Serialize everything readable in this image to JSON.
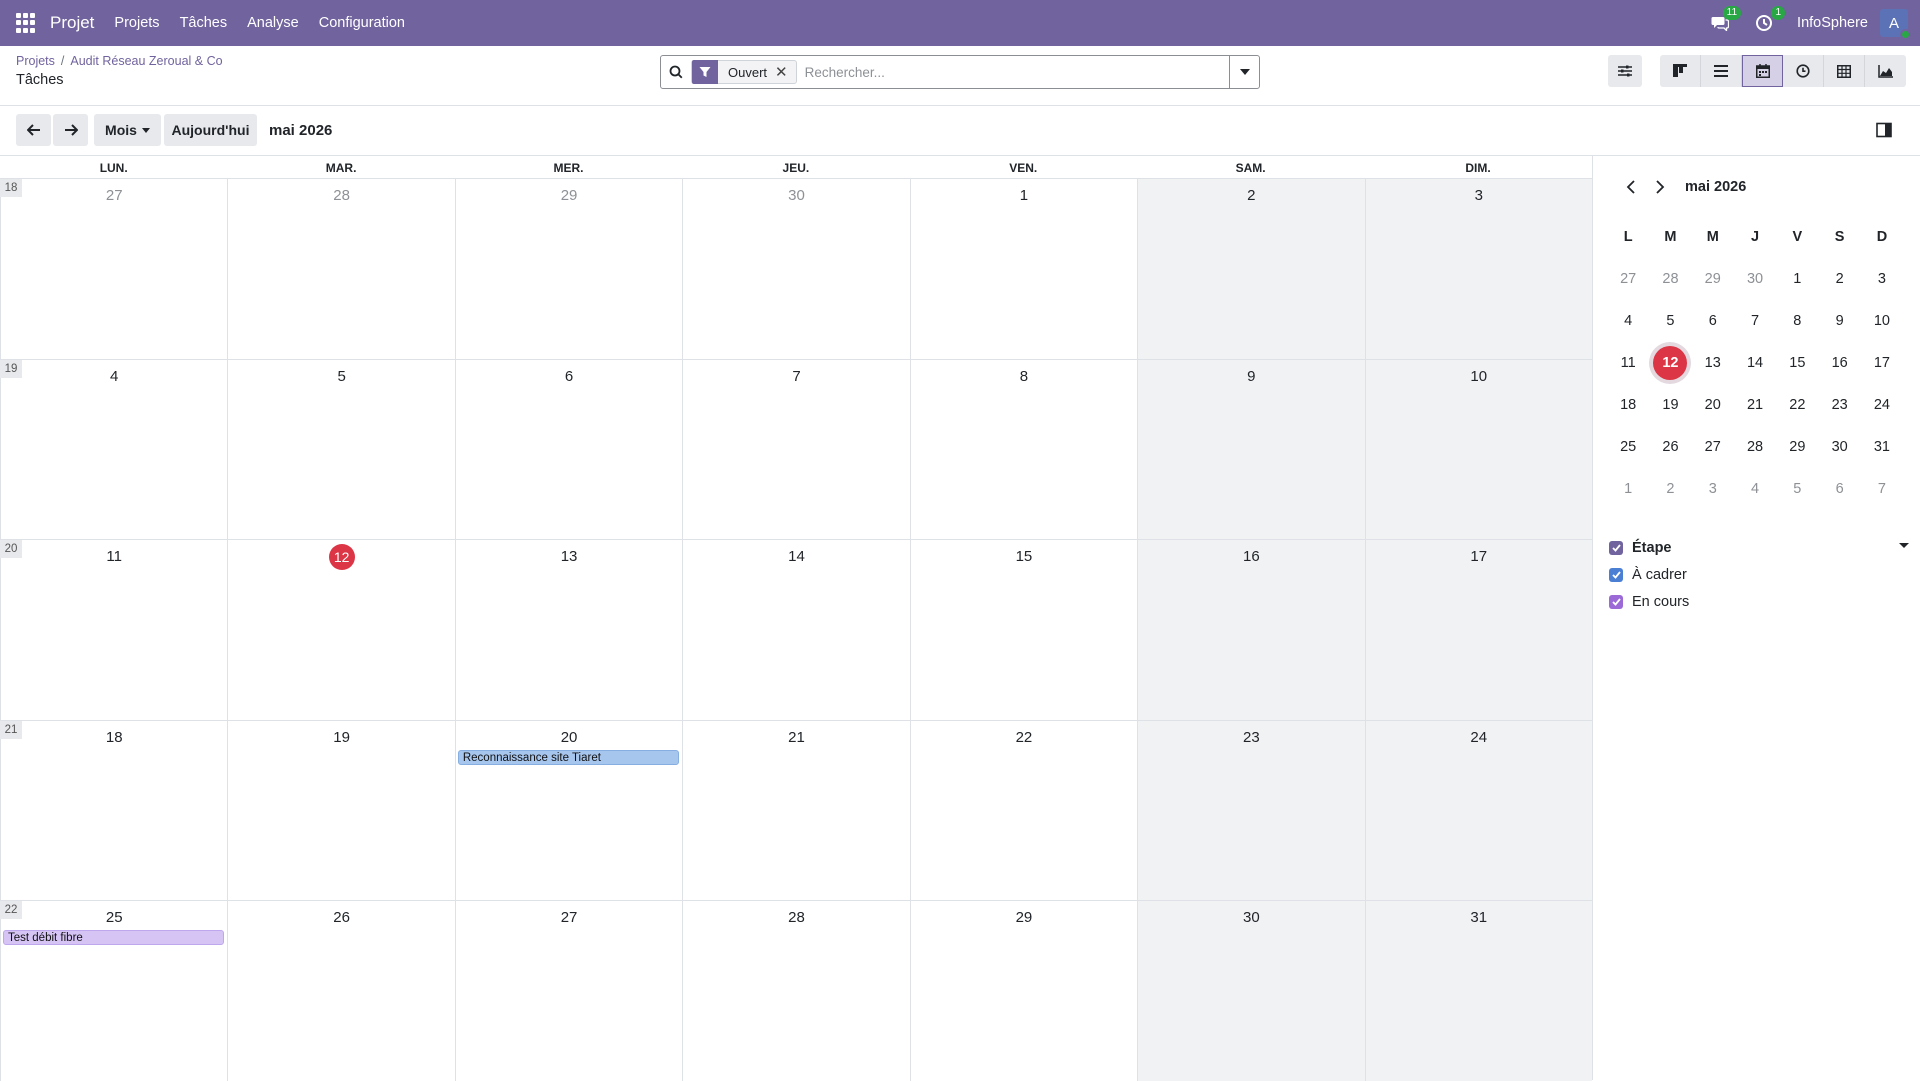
{
  "nav": {
    "app_name": "Projet",
    "menu": [
      "Projets",
      "Tâches",
      "Analyse",
      "Configuration"
    ],
    "chat_count": "11",
    "activity_count": "1",
    "company": "InfoSphere",
    "avatar_letter": "A"
  },
  "breadcrumb": {
    "root": "Projets",
    "project": "Audit Réseau Zeroual & Co"
  },
  "page_title": "Tâches",
  "search": {
    "facet": "Ouvert",
    "placeholder": "Rechercher..."
  },
  "toolbar": {
    "scale": "Mois",
    "today": "Aujourd'hui",
    "range": "mai 2026"
  },
  "calendar": {
    "days_of_week": [
      "LUN.",
      "MAR.",
      "MER.",
      "JEU.",
      "VEN.",
      "SAM.",
      "DIM."
    ],
    "weeks": [
      {
        "number": "18",
        "days": [
          "27",
          "28",
          "29",
          "30",
          "1",
          "2",
          "3"
        ],
        "outside": [
          true,
          true,
          true,
          true,
          false,
          false,
          false
        ]
      },
      {
        "number": "19",
        "days": [
          "4",
          "5",
          "6",
          "7",
          "8",
          "9",
          "10"
        ],
        "outside": [
          false,
          false,
          false,
          false,
          false,
          false,
          false
        ]
      },
      {
        "number": "20",
        "days": [
          "11",
          "12",
          "13",
          "14",
          "15",
          "16",
          "17"
        ],
        "outside": [
          false,
          false,
          false,
          false,
          false,
          false,
          false
        ]
      },
      {
        "number": "21",
        "days": [
          "18",
          "19",
          "20",
          "21",
          "22",
          "23",
          "24"
        ],
        "outside": [
          false,
          false,
          false,
          false,
          false,
          false,
          false
        ]
      },
      {
        "number": "22",
        "days": [
          "25",
          "26",
          "27",
          "28",
          "29",
          "30",
          "31"
        ],
        "outside": [
          false,
          false,
          false,
          false,
          false,
          false,
          false
        ]
      }
    ],
    "today": "12",
    "events": [
      {
        "title": "Reconnaissance site Tiaret",
        "date": "2026-05-20",
        "color": "blue"
      },
      {
        "title": "Test débit fibre",
        "date": "2026-05-25",
        "color": "purple"
      }
    ]
  },
  "mini_calendar": {
    "title": "mai 2026",
    "headers": [
      "L",
      "M",
      "M",
      "J",
      "V",
      "S",
      "D"
    ],
    "rows": [
      [
        "27",
        "28",
        "29",
        "30",
        "1",
        "2",
        "3"
      ],
      [
        "4",
        "5",
        "6",
        "7",
        "8",
        "9",
        "10"
      ],
      [
        "11",
        "12",
        "13",
        "14",
        "15",
        "16",
        "17"
      ],
      [
        "18",
        "19",
        "20",
        "21",
        "22",
        "23",
        "24"
      ],
      [
        "25",
        "26",
        "27",
        "28",
        "29",
        "30",
        "31"
      ],
      [
        "1",
        "2",
        "3",
        "4",
        "5",
        "6",
        "7"
      ]
    ],
    "selected": "12"
  },
  "filters": {
    "title": "Étape",
    "items": [
      {
        "label": "À cadrer",
        "color": "#4a7fd4"
      },
      {
        "label": "En cours",
        "color": "#9b6ad6"
      }
    ]
  },
  "colors": {
    "brand": "#71639e",
    "today": "#dc3545",
    "weekend": "#f1f2f4"
  }
}
